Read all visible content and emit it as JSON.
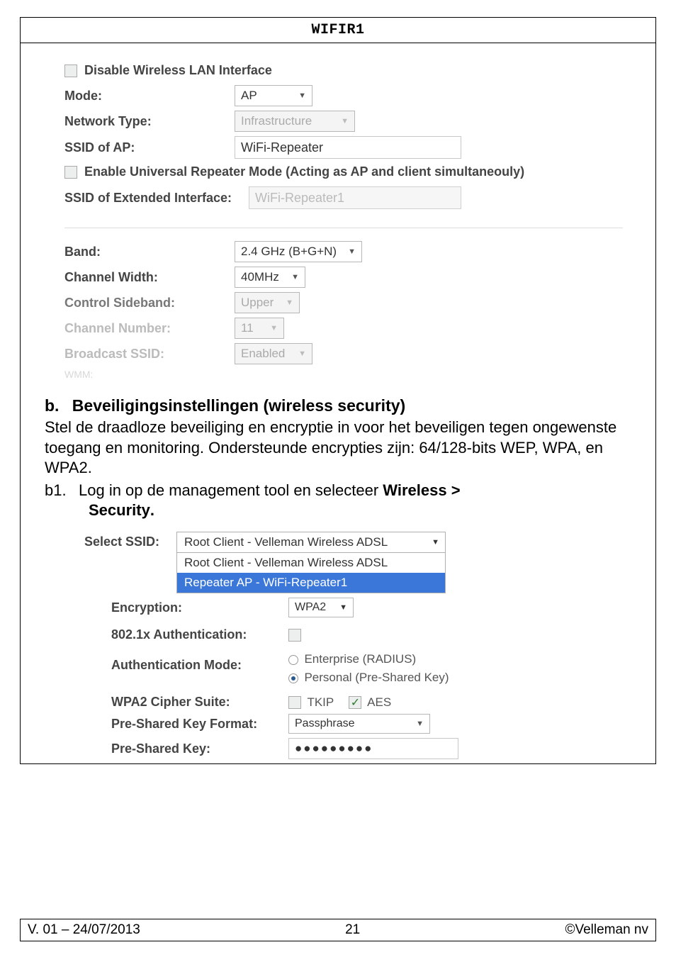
{
  "header": {
    "title": "WIFIR1"
  },
  "form1": {
    "disable_lbl": "Disable Wireless LAN Interface",
    "mode": {
      "label": "Mode:",
      "value": "AP"
    },
    "network_type": {
      "label": "Network Type:",
      "value": "Infrastructure"
    },
    "ssid_ap": {
      "label": "SSID of AP:",
      "value": "WiFi-Repeater"
    },
    "enable_repeater_lbl": "Enable Universal Repeater Mode (Acting as AP and client simultaneouly)",
    "ssid_ext": {
      "label": "SSID of Extended Interface:",
      "value": "WiFi-Repeater1"
    },
    "band": {
      "label": "Band:",
      "value": "2.4 GHz (B+G+N)"
    },
    "ch_width": {
      "label": "Channel Width:",
      "value": "40MHz"
    },
    "ctrl_side": {
      "label": "Control Sideband:",
      "value": "Upper"
    },
    "ch_num": {
      "label": "Channel Number:",
      "value": "11"
    },
    "bcast": {
      "label": "Broadcast SSID:",
      "value": "Enabled"
    },
    "ghost_label": "WMM:"
  },
  "body": {
    "heading_prefix": "b.",
    "heading": "Beveiligingsinstellingen (wireless security)",
    "para": "Stel de draadloze beveiliging en encryptie in voor het beveiligen tegen ongewenste toegang en monitoring. Ondersteunde encrypties zijn: 64/128-bits WEP, WPA, en WPA2.",
    "step_num": "b1.",
    "step_text_1": "Log in op de management tool en selecteer ",
    "step_bold_1": "Wireless > ",
    "step_bold_2": "Security",
    "step_tail": "."
  },
  "form2": {
    "select_ssid": {
      "label": "Select SSID:",
      "selected": "Root Client - Velleman Wireless ADSL",
      "options": [
        "Root Client - Velleman Wireless ADSL",
        "Repeater AP - WiFi-Repeater1"
      ]
    },
    "encryption": {
      "label": "Encryption:",
      "value": "WPA2"
    },
    "auth8021x": {
      "label": "802.1x Authentication:"
    },
    "auth_mode": {
      "label": "Authentication Mode:",
      "opt1": "Enterprise (RADIUS)",
      "opt2": "Personal (Pre-Shared Key)"
    },
    "cipher": {
      "label": "WPA2 Cipher Suite:",
      "tkip": "TKIP",
      "aes": "AES"
    },
    "psk_format": {
      "label": "Pre-Shared Key Format:",
      "value": "Passphrase"
    },
    "psk": {
      "label": "Pre-Shared Key:",
      "value": "●●●●●●●●●"
    }
  },
  "footer": {
    "left": "V. 01 – 24/07/2013",
    "center": "21",
    "right": "©Velleman nv"
  }
}
